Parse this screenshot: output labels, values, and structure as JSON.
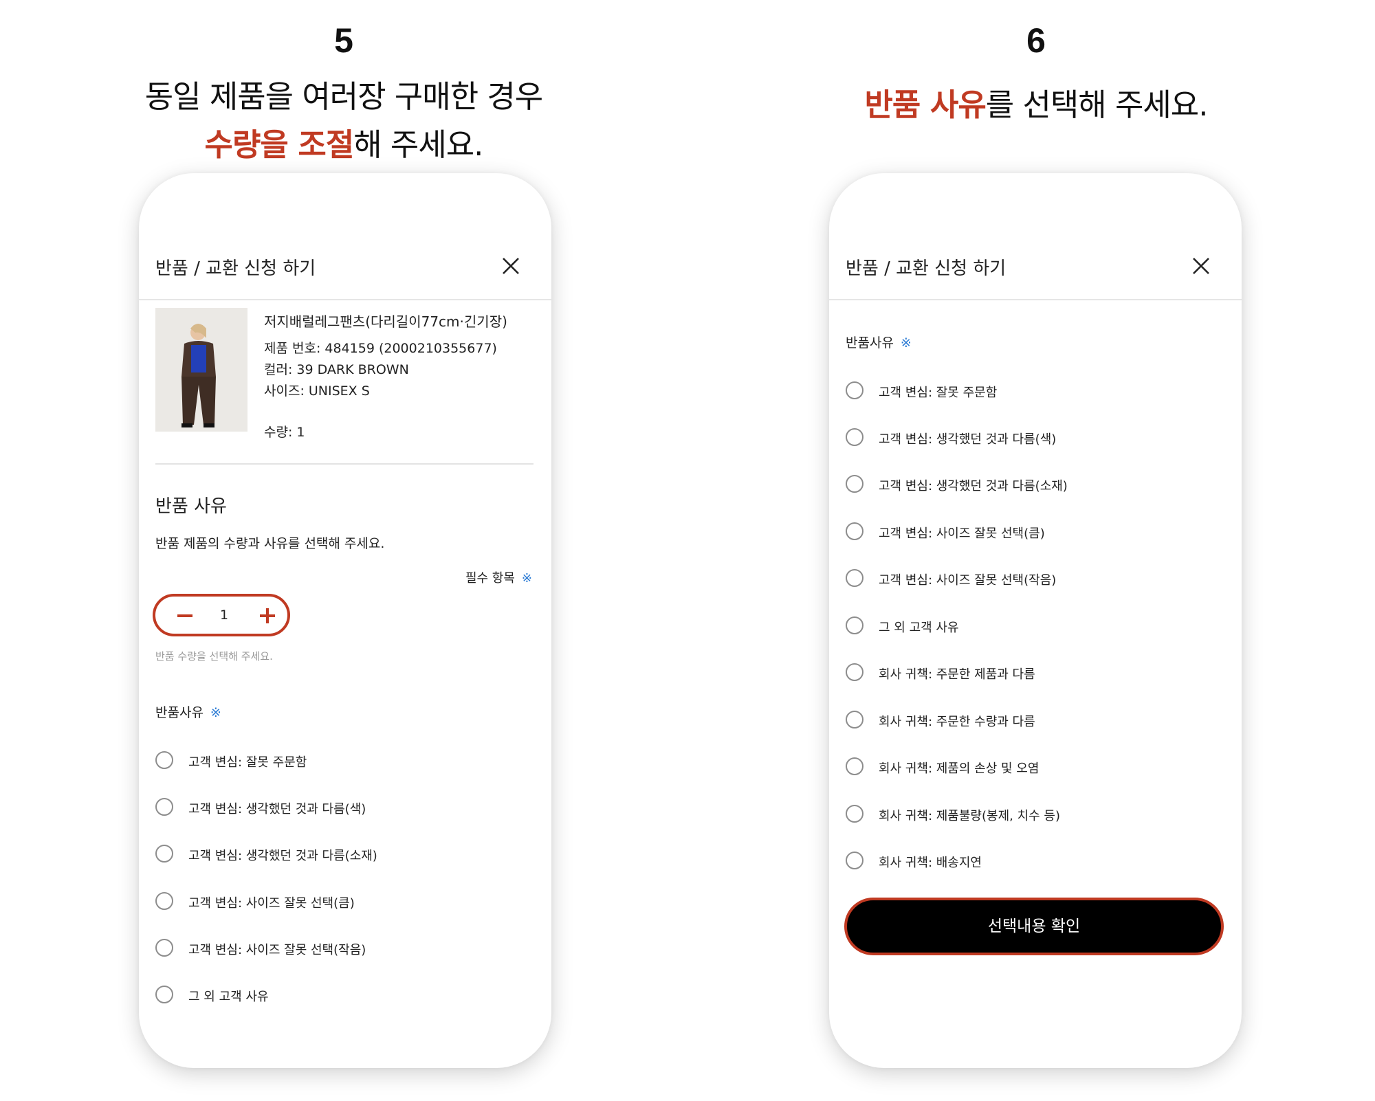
{
  "steps": [
    {
      "number": "5",
      "caption_line1": "동일 제품을 여러장 구매한 경우",
      "caption_line2_highlight": "수량을 조절",
      "caption_line2_rest": "해 주세요."
    },
    {
      "number": "6",
      "caption_highlight": "반품 사유",
      "caption_rest": "를 선택해 주세요."
    }
  ],
  "colors": {
    "accent": "#c03a22",
    "required_mark": "#2a7ad4",
    "button_bg": "#000000"
  },
  "modal": {
    "title": "반품 / 교환 신청 하기",
    "close_icon": "close-icon"
  },
  "product": {
    "name": "저지배럴레그팬츠(다리길이77cm·긴기장)",
    "number": "제품 번호: 484159 (2000210355677)",
    "color": "컬러: 39 DARK BROWN",
    "size": "사이즈: UNISEX S",
    "quantity": "수량: 1"
  },
  "return_section": {
    "title": "반품 사유",
    "description": "반품 제품의 수량과 사유를 선택해 주세요.",
    "required_label": "필수 항목",
    "required_mark": "※",
    "quantity_value": "1",
    "quantity_hint": "반품 수량을 선택해 주세요.",
    "reason_label": "반품사유"
  },
  "reasons": [
    "고객 변심: 잘못 주문함",
    "고객 변심: 생각했던 것과 다름(색)",
    "고객 변심: 생각했던 것과 다름(소재)",
    "고객 변심: 사이즈 잘못 선택(큼)",
    "고객 변심: 사이즈 잘못 선택(작음)",
    "그 외 고객 사유",
    "회사 귀책: 주문한 제품과 다름",
    "회사 귀책: 주문한 수량과 다름",
    "회사 귀책: 제품의 손상 및 오염",
    "회사 귀책: 제품불량(봉제, 치수 등)",
    "회사 귀책: 배송지연"
  ],
  "confirm_button": "선택내용 확인"
}
